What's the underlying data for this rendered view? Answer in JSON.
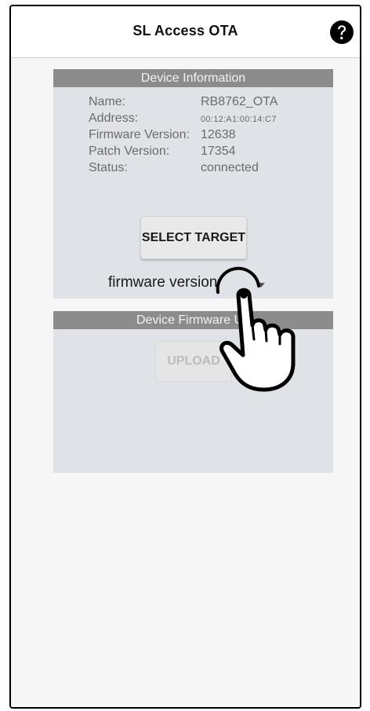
{
  "header": {
    "title": "SL Access OTA",
    "help_icon": "help-circle-icon"
  },
  "device_information": {
    "title": "Device Information",
    "rows": [
      {
        "label": "Name:",
        "value": "RB8762_OTA"
      },
      {
        "label": "Address:",
        "value": "00:12:A1:00:14:C7"
      },
      {
        "label": "Firmware Version:",
        "value": "12638"
      },
      {
        "label": "Patch Version:",
        "value": "17354"
      },
      {
        "label": "Status:",
        "value": "connected"
      }
    ],
    "select_target_label": "SELECT TARGET",
    "firmware_select": {
      "selected": "firmware version",
      "icon": "chevron-down-icon"
    }
  },
  "device_firmware_update": {
    "title": "Device Firmware Up",
    "upload_label": "UPLOAD",
    "upload_enabled": false
  },
  "overlay": {
    "icon": "pointing-hand-icon"
  },
  "colors": {
    "panel_background": "#dfe3e7",
    "panel_header": "#8c8c8c",
    "page_background": "#f6f6f6"
  }
}
